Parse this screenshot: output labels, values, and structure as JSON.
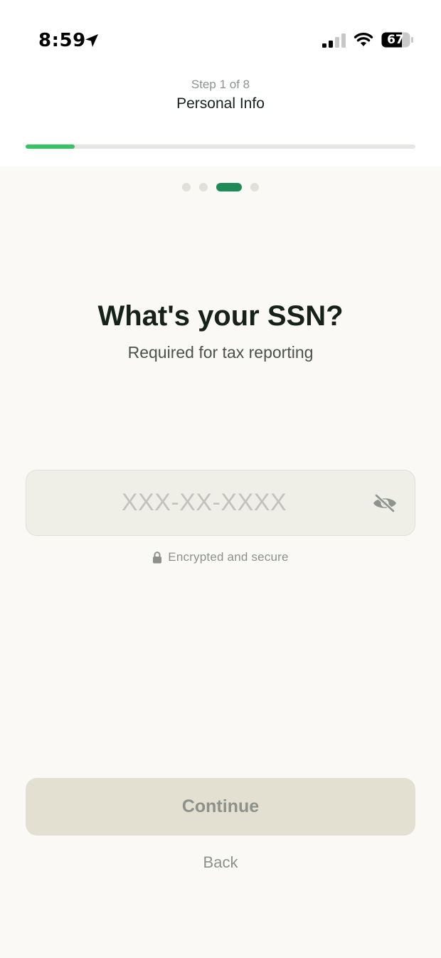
{
  "status_bar": {
    "time": "8:59",
    "battery": "67"
  },
  "header": {
    "step_label": "Step 1 of 8",
    "section_title": "Personal Info",
    "progress_fraction": 0.125
  },
  "pager": {
    "dot_count": 4,
    "active_index": 2
  },
  "question": {
    "title": "What's your SSN?",
    "subtitle": "Required for tax reporting"
  },
  "ssn_input": {
    "value": "",
    "placeholder": "XXX-XX-XXXX"
  },
  "secure_note": {
    "text": "Encrypted and secure"
  },
  "actions": {
    "continue_label": "Continue",
    "back_label": "Back"
  },
  "colors": {
    "progress_fill": "#34C463",
    "active_dot": "#1E8A56",
    "button_disabled_bg": "#E3E0D2",
    "background": "#FAF9F6"
  },
  "icons": {
    "location": "location-arrow-icon",
    "signal": "cellular-signal-icon",
    "wifi": "wifi-icon",
    "battery": "battery-icon",
    "eye": "eye-slash-icon",
    "lock": "lock-icon"
  }
}
